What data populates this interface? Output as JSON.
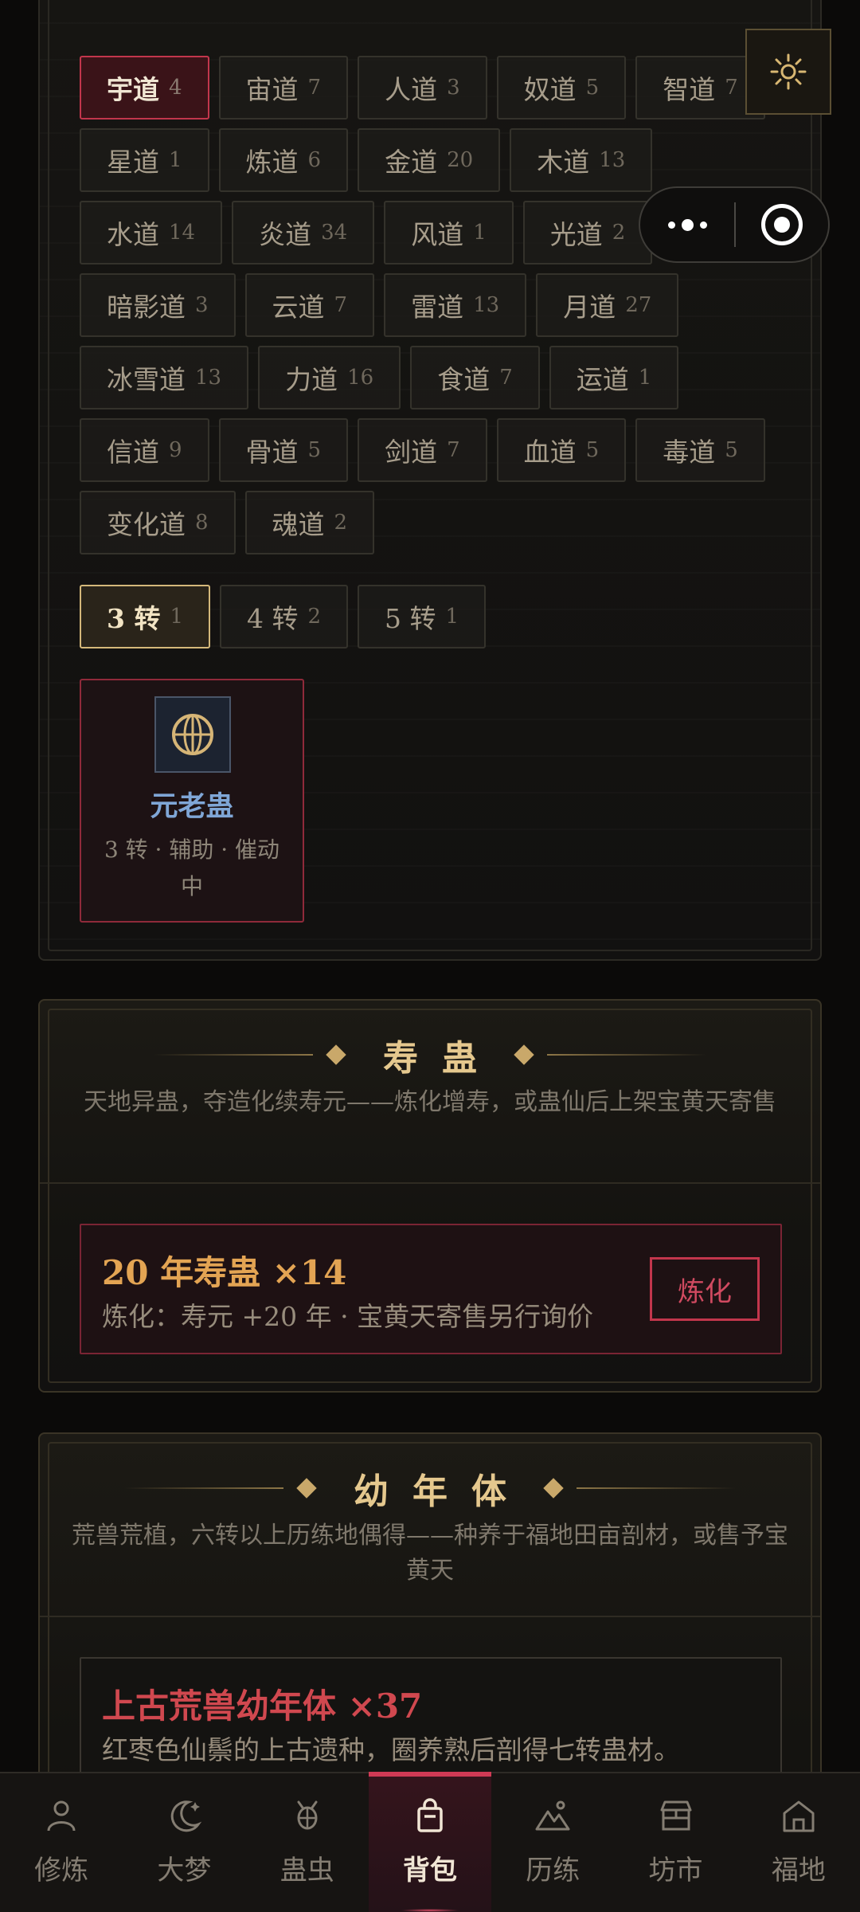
{
  "dao_filters": [
    [
      {
        "name": "宇道",
        "count": "4",
        "active": true
      },
      {
        "name": "宙道",
        "count": "7"
      },
      {
        "name": "人道",
        "count": "3"
      },
      {
        "name": "奴道",
        "count": "5"
      },
      {
        "name": "智道",
        "count": "7"
      }
    ],
    [
      {
        "name": "星道",
        "count": "1"
      },
      {
        "name": "炼道",
        "count": "6"
      },
      {
        "name": "金道",
        "count": "20"
      },
      {
        "name": "木道",
        "count": "13"
      }
    ],
    [
      {
        "name": "水道",
        "count": "14"
      },
      {
        "name": "炎道",
        "count": "34"
      },
      {
        "name": "风道",
        "count": "1"
      },
      {
        "name": "光道",
        "count": "2"
      }
    ],
    [
      {
        "name": "暗影道",
        "count": "3"
      },
      {
        "name": "云道",
        "count": "7"
      },
      {
        "name": "雷道",
        "count": "13"
      },
      {
        "name": "月道",
        "count": "27"
      }
    ],
    [
      {
        "name": "冰雪道",
        "count": "13"
      },
      {
        "name": "力道",
        "count": "16"
      },
      {
        "name": "食道",
        "count": "7"
      },
      {
        "name": "运道",
        "count": "1"
      }
    ],
    [
      {
        "name": "信道",
        "count": "9"
      },
      {
        "name": "骨道",
        "count": "5"
      },
      {
        "name": "剑道",
        "count": "7"
      },
      {
        "name": "血道",
        "count": "5"
      },
      {
        "name": "毒道",
        "count": "5"
      }
    ],
    [
      {
        "name": "变化道",
        "count": "8"
      },
      {
        "name": "魂道",
        "count": "2"
      }
    ]
  ],
  "zhuan_filters": [
    {
      "name": "3 转",
      "count": "1",
      "active": true
    },
    {
      "name": "4 转",
      "count": "2"
    },
    {
      "name": "5 转",
      "count": "1"
    }
  ],
  "gu_card": {
    "icon": "coin-globe-icon",
    "name": "元老蛊",
    "desc": "3 转 · 辅助 · 催动中"
  },
  "shou_section": {
    "title": "寿蛊",
    "desc": "天地异蛊，夺造化续寿元——炼化增寿，或蛊仙后上架宝黄天寄售",
    "item_title": "20 年寿蛊 ×14",
    "item_sub": "炼化：寿元 +20 年 · 宝黄天寄售另行询价",
    "button": "炼化"
  },
  "you_section": {
    "title": "幼年体",
    "desc": "荒兽荒植，六转以上历练地偶得——种养于福地田亩剖材，或售予宝黄天",
    "item_title": "上古荒兽幼年体 ×37",
    "item_sub": "红枣色仙鬃的上古遗种，圈养熟后剖得七转蛊材。"
  },
  "nav": [
    {
      "label": "修炼",
      "icon": "person-icon"
    },
    {
      "label": "大梦",
      "icon": "moon-icon"
    },
    {
      "label": "蛊虫",
      "icon": "bug-icon"
    },
    {
      "label": "背包",
      "icon": "bag-icon",
      "active": true
    },
    {
      "label": "历练",
      "icon": "mountain-icon"
    },
    {
      "label": "坊市",
      "icon": "shop-icon"
    },
    {
      "label": "福地",
      "icon": "home-icon"
    }
  ],
  "colors": {
    "accent": "#c2364c",
    "gold": "#e5c88e",
    "blue": "#7fa6d6",
    "orange": "#e3a453"
  }
}
